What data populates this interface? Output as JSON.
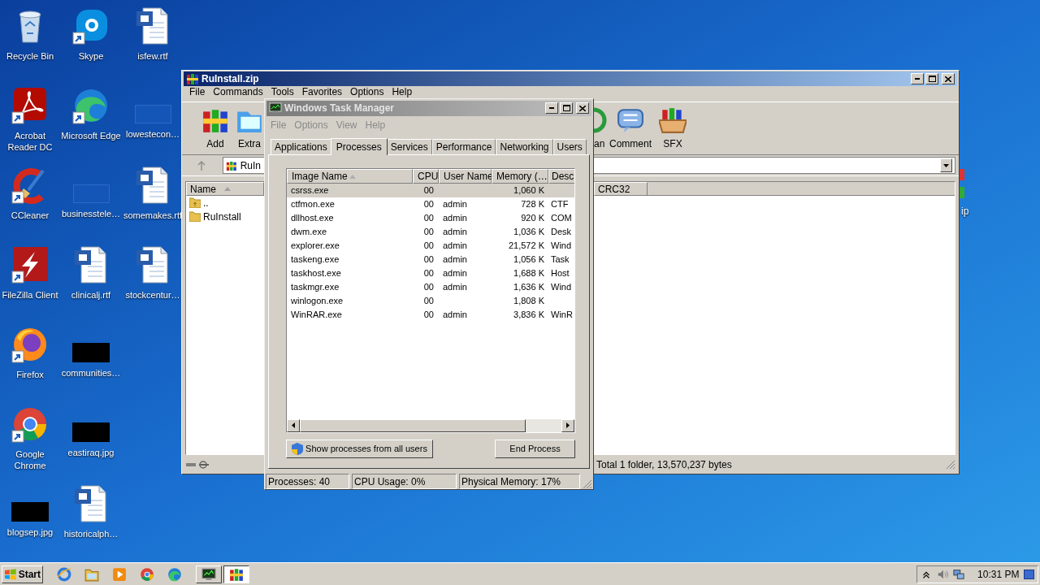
{
  "desktop": {
    "icons": [
      {
        "label": "Recycle Bin",
        "kind": "recycle",
        "shortcut": false
      },
      {
        "label": "Acrobat Reader DC",
        "kind": "acrobat",
        "shortcut": true
      },
      {
        "label": "CCleaner",
        "kind": "ccleaner",
        "shortcut": true
      },
      {
        "label": "FileZilla Client",
        "kind": "filezilla",
        "shortcut": true
      },
      {
        "label": "Firefox",
        "kind": "firefox",
        "shortcut": true
      },
      {
        "label": "Google Chrome",
        "kind": "chrome",
        "shortcut": true
      },
      {
        "label": "blogsep.jpg",
        "kind": "dark",
        "shortcut": false
      },
      {
        "label": "Skype",
        "kind": "skype",
        "shortcut": true
      },
      {
        "label": "Microsoft Edge",
        "kind": "edge",
        "shortcut": true
      },
      {
        "label": "businesstele…",
        "kind": "blank",
        "shortcut": false
      },
      {
        "label": "clinicalj.rtf",
        "kind": "word",
        "shortcut": false
      },
      {
        "label": "communities…",
        "kind": "dark",
        "shortcut": false
      },
      {
        "label": "eastiraq.jpg",
        "kind": "dark",
        "shortcut": false
      },
      {
        "label": "historicalph…",
        "kind": "word",
        "shortcut": false
      },
      {
        "label": "isfew.rtf",
        "kind": "word",
        "shortcut": false
      },
      {
        "label": "lowestecon…",
        "kind": "blank",
        "shortcut": false
      },
      {
        "label": "somemakes.rtf",
        "kind": "word",
        "shortcut": false
      },
      {
        "label": "stockcentur…",
        "kind": "word",
        "shortcut": false
      }
    ],
    "partial_icon": {
      "label": "ip"
    }
  },
  "winrar": {
    "title": "RuInstall.zip",
    "menu": [
      "File",
      "Commands",
      "Tools",
      "Favorites",
      "Options",
      "Help"
    ],
    "toolbar": [
      {
        "label": "Add",
        "kind": "add"
      },
      {
        "label": "Extra",
        "kind": "extract"
      },
      {
        "label": "an",
        "kind": "scan"
      },
      {
        "label": "Comment",
        "kind": "comment"
      },
      {
        "label": "SFX",
        "kind": "sfx"
      }
    ],
    "address": "RuIn",
    "columns": [
      {
        "label": "Name",
        "sorted": true
      },
      {
        "label": "CRC32",
        "sorted": false
      }
    ],
    "rows": [
      {
        "name": "..",
        "kind": "up"
      },
      {
        "name": "RuInstall",
        "kind": "folder"
      }
    ],
    "status": "Total 1 folder, 13,570,237 bytes"
  },
  "task_manager": {
    "title": "Windows Task Manager",
    "menu": [
      "File",
      "Options",
      "View",
      "Help"
    ],
    "tabs": [
      {
        "label": "Applications",
        "selected": false
      },
      {
        "label": "Processes",
        "selected": true
      },
      {
        "label": "Services",
        "selected": false
      },
      {
        "label": "Performance",
        "selected": false
      },
      {
        "label": "Networking",
        "selected": false
      },
      {
        "label": "Users",
        "selected": false
      }
    ],
    "columns": [
      {
        "label": "Image Name",
        "sorted": true
      },
      {
        "label": "CPU",
        "sorted": false
      },
      {
        "label": "User Name",
        "sorted": false
      },
      {
        "label": "Memory (…",
        "sorted": false
      },
      {
        "label": "Desc",
        "sorted": false
      }
    ],
    "rows": [
      {
        "cells": [
          "csrss.exe",
          "00",
          "",
          "1,060 K",
          ""
        ],
        "selected": true
      },
      {
        "cells": [
          "ctfmon.exe",
          "00",
          "admin",
          "728 K",
          "CTF"
        ],
        "selected": false
      },
      {
        "cells": [
          "dllhost.exe",
          "00",
          "admin",
          "920 K",
          "COM"
        ],
        "selected": false
      },
      {
        "cells": [
          "dwm.exe",
          "00",
          "admin",
          "1,036 K",
          "Desk"
        ],
        "selected": false
      },
      {
        "cells": [
          "explorer.exe",
          "00",
          "admin",
          "21,572 K",
          "Wind"
        ],
        "selected": false
      },
      {
        "cells": [
          "taskeng.exe",
          "00",
          "admin",
          "1,056 K",
          "Task"
        ],
        "selected": false
      },
      {
        "cells": [
          "taskhost.exe",
          "00",
          "admin",
          "1,688 K",
          "Host"
        ],
        "selected": false
      },
      {
        "cells": [
          "taskmgr.exe",
          "00",
          "admin",
          "1,636 K",
          "Wind"
        ],
        "selected": false
      },
      {
        "cells": [
          "winlogon.exe",
          "00",
          "",
          "1,808 K",
          ""
        ],
        "selected": false
      },
      {
        "cells": [
          "WinRAR.exe",
          "00",
          "admin",
          "3,836 K",
          "WinR"
        ],
        "selected": false
      }
    ],
    "buttons": [
      {
        "label": "Show processes from all users",
        "kind": "shield"
      },
      {
        "label": "End Process",
        "kind": "plain"
      }
    ],
    "status": [
      "Processes: 40",
      "CPU Usage: 0%",
      "Physical Memory: 17%"
    ]
  },
  "taskbar": {
    "start": "Start",
    "quick_launch": [
      {
        "kind": "ie"
      },
      {
        "kind": "explorer"
      },
      {
        "kind": "media"
      },
      {
        "kind": "chrome"
      },
      {
        "kind": "edge"
      }
    ],
    "tasks": [
      {
        "kind": "taskmgr",
        "selected": false
      },
      {
        "kind": "winrar",
        "selected": true
      }
    ],
    "tray": [
      {
        "kind": "chevron"
      },
      {
        "kind": "speaker"
      },
      {
        "kind": "network"
      }
    ],
    "clock": "10:31 PM"
  }
}
